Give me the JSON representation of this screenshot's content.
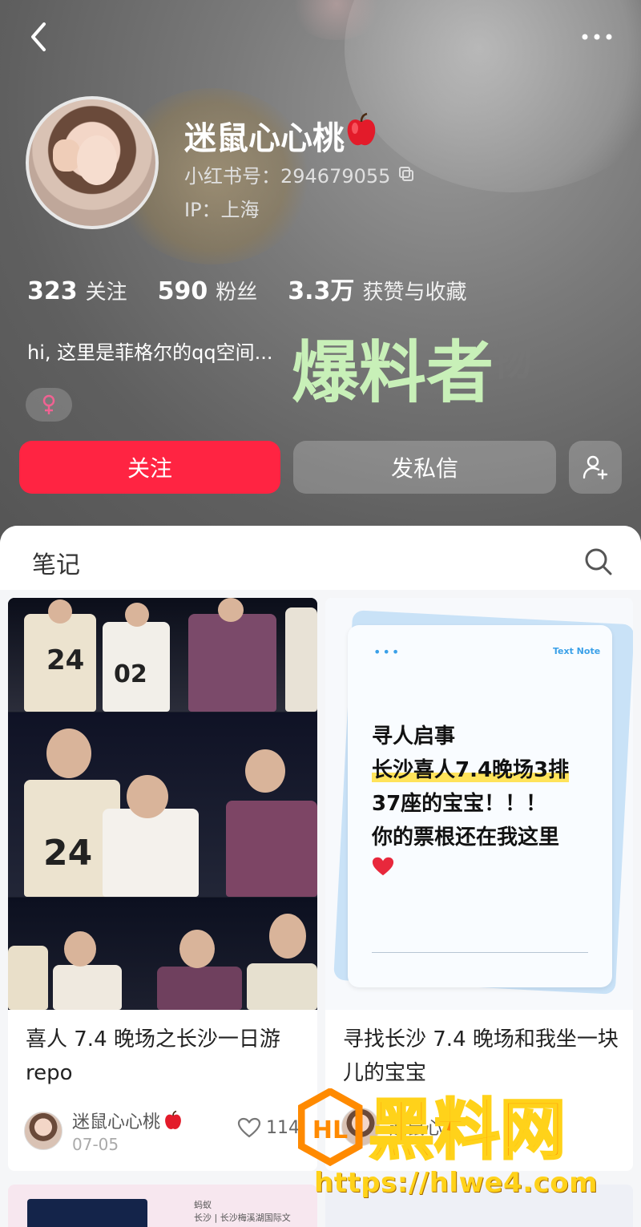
{
  "header": {
    "name": "迷鼠心心桃",
    "account_id": "小红书号：294679055",
    "ip": "IP：上海",
    "bio": "hi, 这里是菲格尔的qq空间...",
    "watermark_text": "爆料者",
    "ghost_text": "合物",
    "stats": [
      {
        "num": "323",
        "label": "关注"
      },
      {
        "num": "590",
        "label": "粉丝"
      },
      {
        "num": "3.3万",
        "label": "获赞与收藏"
      }
    ],
    "gender_symbol": "♀"
  },
  "actions": {
    "follow_label": "关注",
    "message_label": "发私信"
  },
  "tabs": {
    "notes_label": "笔记"
  },
  "notes": [
    {
      "title": "喜人 7.4 晚场之长沙一日游repo",
      "author": "迷鼠心心桃",
      "date": "07-05",
      "likes": "114",
      "jersey_a": "24",
      "jersey_b": "02",
      "jersey_c": "24"
    },
    {
      "title": "寻找长沙 7.4 晚场和我坐一块儿的宝宝",
      "author": "迷鼠心",
      "note_tag": "Text Note",
      "note_dots": "•••",
      "note_lines": [
        "寻人启事",
        "长沙喜人7.4晚场3排",
        "37座的宝宝！！！",
        "你的票根还在我这里"
      ]
    }
  ],
  "bottom_card": {
    "text_line1": "蚂蚁",
    "text_line2": "长沙 | 长沙梅溪湖国际文"
  },
  "overlay": {
    "logo_text": "黑料网",
    "url": "https://hlwe4.com"
  },
  "colors": {
    "accent": "#ff2442",
    "watermark_green": "#c8f0b8",
    "note_blue": "#3aa0e8",
    "logo_orange": "#ff8a00",
    "logo_yellow": "#ffd21a"
  }
}
